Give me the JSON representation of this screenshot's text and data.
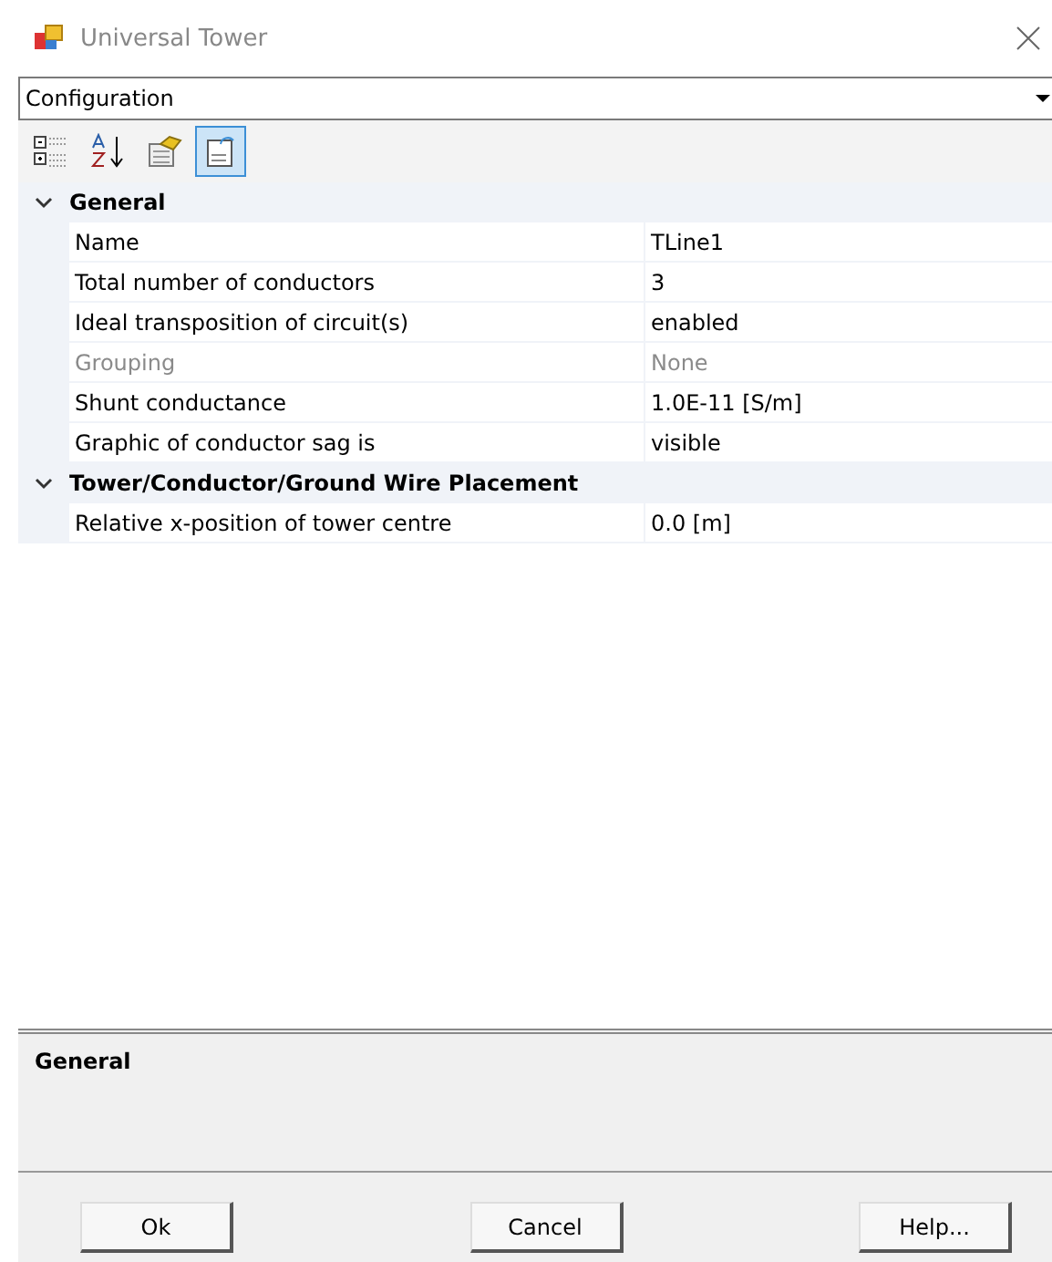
{
  "window": {
    "title": "Universal Tower"
  },
  "object_selector": {
    "value": "Configuration"
  },
  "toolbar": [
    {
      "kind": "categorized",
      "selected": false
    },
    {
      "kind": "alphabetical",
      "selected": false
    },
    {
      "kind": "property-pages",
      "selected": false
    },
    {
      "kind": "description",
      "selected": true
    }
  ],
  "categories": [
    {
      "name": "General",
      "expanded": true,
      "properties": [
        {
          "name": "Name",
          "value": "TLine1",
          "disabled": false
        },
        {
          "name": "Total number of conductors",
          "value": "3",
          "disabled": false
        },
        {
          "name": "Ideal transposition of circuit(s)",
          "value": "enabled",
          "disabled": false
        },
        {
          "name": "Grouping",
          "value": "None",
          "disabled": true
        },
        {
          "name": "Shunt conductance",
          "value": "1.0E-11 [S/m]",
          "disabled": false
        },
        {
          "name": "Graphic of conductor sag is",
          "value": "visible",
          "disabled": false
        }
      ]
    },
    {
      "name": "Tower/Conductor/Ground Wire Placement",
      "expanded": true,
      "properties": [
        {
          "name": "Relative x-position of tower centre",
          "value": "0.0 [m]",
          "disabled": false
        }
      ]
    }
  ],
  "description": {
    "title": "General"
  },
  "buttons": [
    "Ok",
    "Cancel",
    "Help..."
  ]
}
